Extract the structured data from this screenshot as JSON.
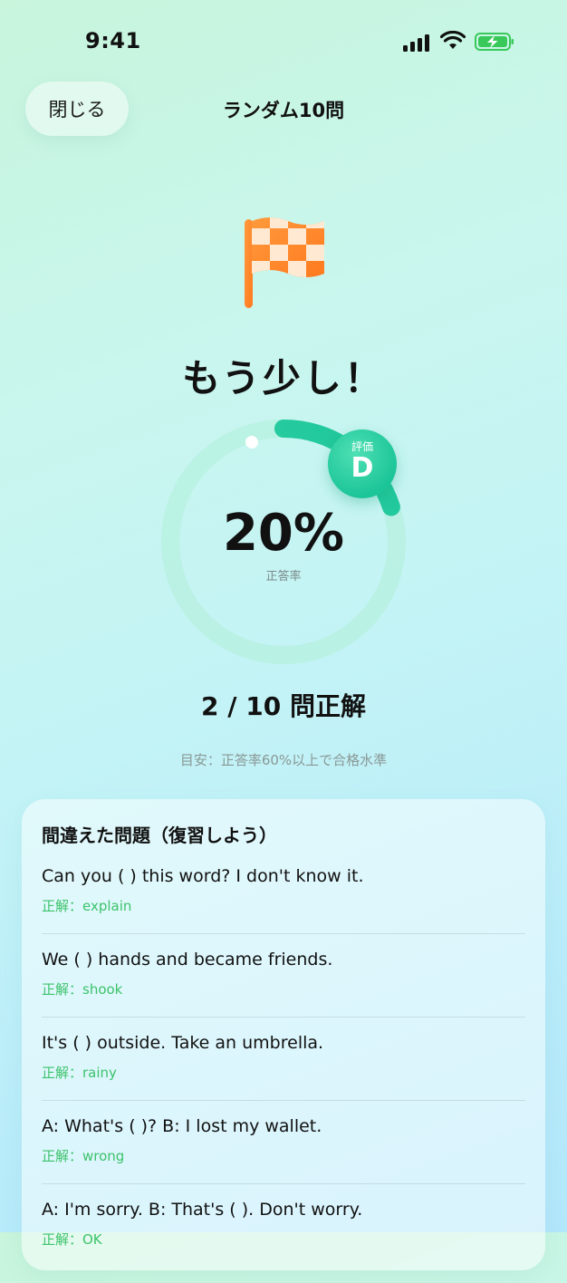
{
  "status_bar": {
    "time": "9:41"
  },
  "nav": {
    "close_label": "閉じる",
    "title": "ランダム10問"
  },
  "result": {
    "headline": "もう少し！",
    "percent": "20%",
    "percent_label": "正答率",
    "progress": 0.2,
    "grade_label": "評価",
    "grade": "D",
    "score": "2 / 10 問正解",
    "guideline": "目安：正答率60%以上で合格水準"
  },
  "review": {
    "title": "間違えた問題（復習しよう）",
    "items": [
      {
        "question": "Can you ( ) this word? I don't know it.",
        "answer": "正解：explain"
      },
      {
        "question": "We ( ) hands and became friends.",
        "answer": "正解：shook"
      },
      {
        "question": "It's ( ) outside. Take an umbrella.",
        "answer": "正解：rainy"
      },
      {
        "question": "A: What's ( )? B: I lost my wallet.",
        "answer": "正解：wrong"
      },
      {
        "question": "A: I'm sorry. B: That's ( ). Don't worry.",
        "answer": "正解：OK"
      }
    ]
  },
  "colors": {
    "accent": "#1cc598",
    "correct_text": "#3cc36a",
    "flag": "#ff8a2a"
  }
}
